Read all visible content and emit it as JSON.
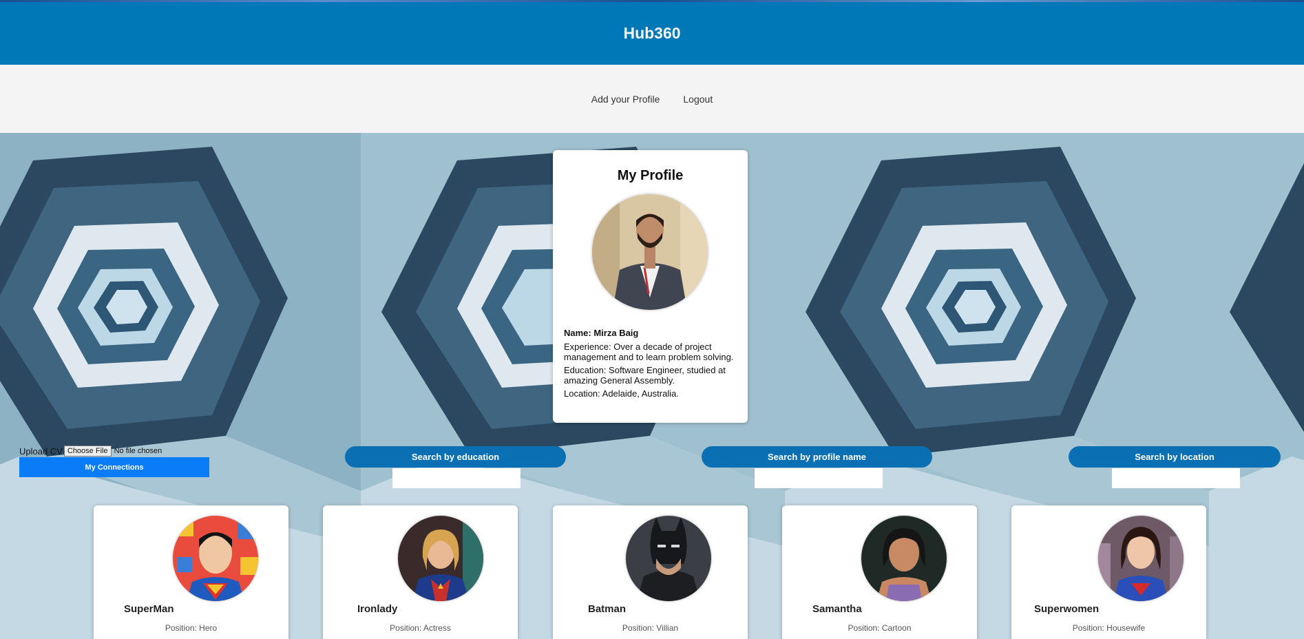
{
  "app": {
    "title": "Hub360"
  },
  "nav": {
    "items": [
      {
        "label": "Add your Profile"
      },
      {
        "label": "Logout"
      }
    ]
  },
  "profile": {
    "heading": "My Profile",
    "name": "Name: Mirza Baig",
    "experience": "Experience: Over a decade of project management and to learn problem solving.",
    "education": "Education: Software Engineer, studied at amazing General Assembly.",
    "location": "Location: Adelaide, Australia."
  },
  "upload": {
    "label": "Upload CV",
    "button": "Choose File",
    "status": "No file chosen"
  },
  "connections": {
    "label": "My Connections"
  },
  "search": {
    "education": {
      "label": "Search by education",
      "value": ""
    },
    "profile_name": {
      "label": "Search by profile name",
      "value": ""
    },
    "location": {
      "label": "Search by location",
      "value": ""
    }
  },
  "people": [
    {
      "name": "SuperMan",
      "position": "Position: Hero"
    },
    {
      "name": "Ironlady",
      "position": "Position: Actress"
    },
    {
      "name": "Batman",
      "position": "Position: Villian"
    },
    {
      "name": "Samantha",
      "position": "Position: Cartoon"
    },
    {
      "name": "Superwomen",
      "position": "Position: Housewife"
    }
  ],
  "colors": {
    "header": "#0077b6",
    "nav_bg": "#f4f4f4",
    "search_button": "#0a70b3",
    "connections_button": "#0a7cf7"
  }
}
